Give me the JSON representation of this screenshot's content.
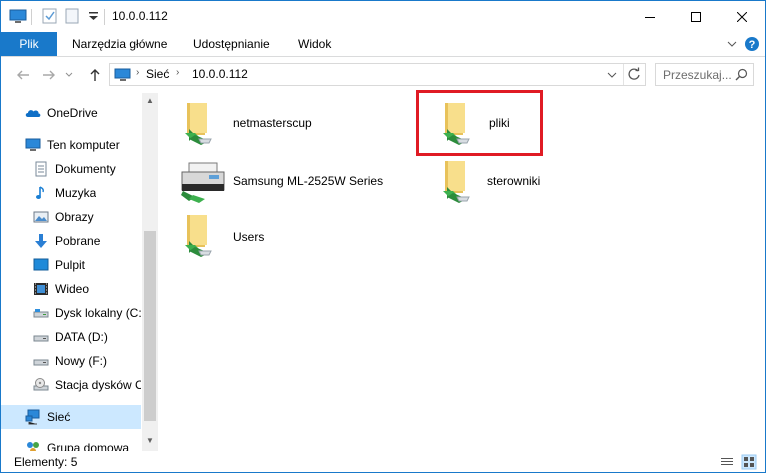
{
  "window": {
    "title": "10.0.0.112",
    "accent_color": "#1979ca"
  },
  "ribbon": {
    "tabs": [
      {
        "label": "Plik"
      },
      {
        "label": "Narzędzia główne"
      },
      {
        "label": "Udostępnianie"
      },
      {
        "label": "Widok"
      }
    ]
  },
  "address": {
    "crumbs": [
      "Sieć",
      "10.0.0.112"
    ],
    "search_placeholder": "Przeszukaj..."
  },
  "nav": {
    "items": [
      {
        "label": "OneDrive",
        "icon": "onedrive-icon"
      },
      {
        "label": "Ten komputer",
        "icon": "computer-icon"
      },
      {
        "label": "Dokumenty",
        "icon": "documents-icon"
      },
      {
        "label": "Muzyka",
        "icon": "music-icon"
      },
      {
        "label": "Obrazy",
        "icon": "pictures-icon"
      },
      {
        "label": "Pobrane",
        "icon": "downloads-icon"
      },
      {
        "label": "Pulpit",
        "icon": "desktop-icon"
      },
      {
        "label": "Wideo",
        "icon": "video-icon"
      },
      {
        "label": "Dysk lokalny (C:)",
        "icon": "drive-icon"
      },
      {
        "label": "DATA (D:)",
        "icon": "drive-icon"
      },
      {
        "label": "Nowy (F:)",
        "icon": "drive-icon"
      },
      {
        "label": "Stacja dysków C",
        "icon": "cd-drive-icon"
      },
      {
        "label": "Sieć",
        "icon": "network-icon",
        "selected": true
      },
      {
        "label": "Grupa domowa",
        "icon": "homegroup-icon"
      }
    ]
  },
  "content": {
    "items": [
      {
        "label": "netmasterscup",
        "icon": "shared-folder-icon"
      },
      {
        "label": "pliki",
        "icon": "shared-folder-icon",
        "highlighted": true
      },
      {
        "label": "Samsung ML-2525W Series",
        "icon": "printer-icon"
      },
      {
        "label": "sterowniki",
        "icon": "shared-folder-icon"
      },
      {
        "label": "Users",
        "icon": "shared-folder-icon"
      }
    ],
    "highlight_color": "#e01b24"
  },
  "status": {
    "text": "Elementy: 5"
  }
}
